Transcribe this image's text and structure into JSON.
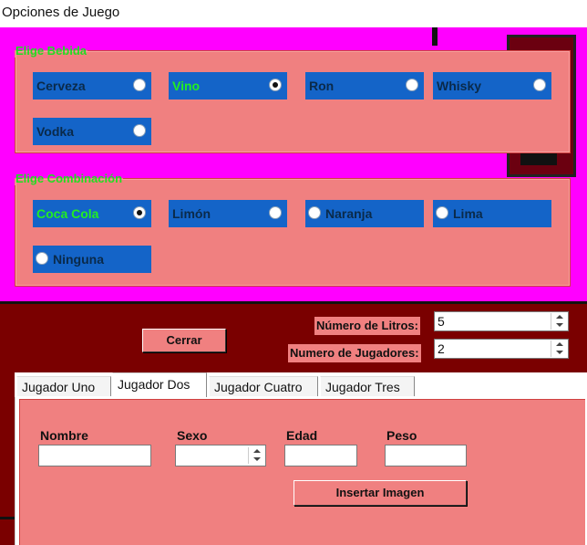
{
  "window": {
    "title": "Opciones de Juego"
  },
  "bebida": {
    "legend": "Elige Bebida",
    "options": [
      {
        "label": "Cerveza",
        "checked": false
      },
      {
        "label": "Vino",
        "checked": true
      },
      {
        "label": "Ron",
        "checked": false
      },
      {
        "label": "Whisky",
        "checked": false
      },
      {
        "label": "Vodka",
        "checked": false
      }
    ]
  },
  "combinacion": {
    "legend": "Elige Combinación",
    "options": [
      {
        "label": "Coca Cola",
        "checked": true
      },
      {
        "label": "Limón",
        "checked": false
      },
      {
        "label": "Naranja",
        "checked": false
      },
      {
        "label": "Lima",
        "checked": false
      },
      {
        "label": "Ninguna",
        "checked": false
      }
    ]
  },
  "cerrar_label": "Cerrar",
  "litros": {
    "label": "Número de Litros:",
    "value": "5"
  },
  "jugadores": {
    "label": "Numero de Jugadores:",
    "value": "2"
  },
  "tabs": [
    {
      "label": "Jugador Uno",
      "active": false
    },
    {
      "label": "Jugador Dos",
      "active": true
    },
    {
      "label": "Jugador Cuatro",
      "active": false
    },
    {
      "label": "Jugador Tres",
      "active": false
    }
  ],
  "player_form": {
    "nombre_label": "Nombre",
    "nombre_value": "",
    "sexo_label": "Sexo",
    "sexo_value": "",
    "edad_label": "Edad",
    "edad_value": "",
    "peso_label": "Peso",
    "peso_value": "",
    "insertar_imagen_label": "Insertar Imagen"
  },
  "colors": {
    "form_bg": "#f08080",
    "radio_bg": "#1464c8",
    "checked_text": "#22ee22",
    "canvas_bg": "#ff00ff"
  }
}
